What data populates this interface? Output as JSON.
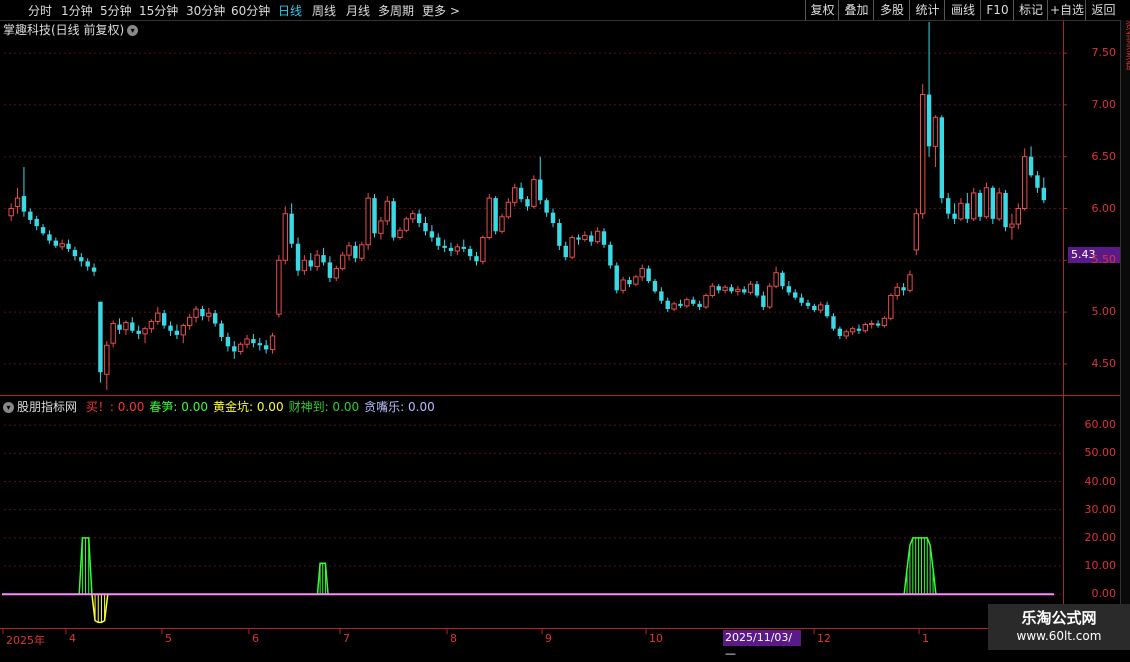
{
  "toolbar": {
    "periods": [
      "分时",
      "1分钟",
      "5分钟",
      "15分钟",
      "30分钟",
      "60分钟",
      "日线",
      "周线",
      "月线",
      "多周期",
      "更多 >"
    ],
    "active_period": "日线",
    "right_buttons": [
      "复权",
      "叠加",
      "多股",
      "统计",
      "画线",
      "F10",
      "标记",
      "+自选",
      "返回"
    ]
  },
  "chart_title": "掌趣科技(日线 前复权)",
  "price_axis": [
    "7.50",
    "7.00",
    "6.50",
    "6.00",
    "5.50",
    "5.00",
    "4.50"
  ],
  "current_price_tag": "5.43",
  "indicator": {
    "name": "股朋指标网",
    "items": [
      {
        "label": "买！:",
        "value": "0.00",
        "color": "#ff3333"
      },
      {
        "label": "春笋:",
        "value": "0.00",
        "color": "#33ff33"
      },
      {
        "label": "黄金坑:",
        "value": "0.00",
        "color": "#ffff33"
      },
      {
        "label": "财神到:",
        "value": "0.00",
        "color": "#33cc33"
      },
      {
        "label": "贪嘴乐:",
        "value": "0.00",
        "color": "#bbbbff"
      }
    ],
    "axis": [
      "60.00",
      "50.00",
      "40.00",
      "30.00",
      "20.00",
      "10.00",
      "0.00"
    ]
  },
  "date_axis": {
    "labels": [
      "2025年",
      "4",
      "5",
      "6",
      "7",
      "8",
      "9",
      "10",
      "11",
      "12",
      "1"
    ],
    "highlight": "2025/11/03/—"
  },
  "watermark": {
    "line1": "乐淘公式网",
    "line2": "www.60lt.com"
  },
  "side_panel_text": "资金买卖盘",
  "colors": {
    "up": "#e74c4c",
    "down": "#3ad9e6",
    "grid": "#5a1010",
    "axis": "#b22222",
    "baseline": "#ff88ff"
  },
  "chart_data": {
    "type": "candlestick",
    "ylim": [
      4.2,
      7.8
    ],
    "candles": [
      [
        5.93,
        6.05,
        5.88,
        6.0
      ],
      [
        6.02,
        6.2,
        5.95,
        6.1
      ],
      [
        6.12,
        6.4,
        5.92,
        5.97
      ],
      [
        5.97,
        6.0,
        5.85,
        5.89
      ],
      [
        5.9,
        5.93,
        5.79,
        5.83
      ],
      [
        5.82,
        5.85,
        5.74,
        5.76
      ],
      [
        5.75,
        5.79,
        5.66,
        5.69
      ],
      [
        5.69,
        5.72,
        5.62,
        5.64
      ],
      [
        5.63,
        5.7,
        5.6,
        5.66
      ],
      [
        5.66,
        5.7,
        5.58,
        5.61
      ],
      [
        5.6,
        5.63,
        5.5,
        5.54
      ],
      [
        5.53,
        5.57,
        5.44,
        5.49
      ],
      [
        5.49,
        5.52,
        5.4,
        5.44
      ],
      [
        5.43,
        5.47,
        5.35,
        5.39
      ],
      [
        5.1,
        5.1,
        4.32,
        4.42
      ],
      [
        4.4,
        4.72,
        4.25,
        4.68
      ],
      [
        4.7,
        4.92,
        4.66,
        4.89
      ],
      [
        4.88,
        4.94,
        4.79,
        4.83
      ],
      [
        4.83,
        4.92,
        4.78,
        4.9
      ],
      [
        4.9,
        4.95,
        4.8,
        4.82
      ],
      [
        4.82,
        4.87,
        4.74,
        4.79
      ],
      [
        4.79,
        4.86,
        4.7,
        4.84
      ],
      [
        4.84,
        4.93,
        4.8,
        4.91
      ],
      [
        4.91,
        5.05,
        4.88,
        4.99
      ],
      [
        4.99,
        5.02,
        4.84,
        4.87
      ],
      [
        4.87,
        4.91,
        4.77,
        4.82
      ],
      [
        4.82,
        4.88,
        4.74,
        4.78
      ],
      [
        4.78,
        4.89,
        4.7,
        4.87
      ],
      [
        4.87,
        4.98,
        4.83,
        4.95
      ],
      [
        4.95,
        5.06,
        4.9,
        5.03
      ],
      [
        5.03,
        5.06,
        4.92,
        4.96
      ],
      [
        4.96,
        5.04,
        4.91,
        4.99
      ],
      [
        4.99,
        5.02,
        4.86,
        4.89
      ],
      [
        4.89,
        4.92,
        4.72,
        4.76
      ],
      [
        4.76,
        4.8,
        4.62,
        4.67
      ],
      [
        4.67,
        4.72,
        4.55,
        4.62
      ],
      [
        4.62,
        4.71,
        4.59,
        4.69
      ],
      [
        4.69,
        4.78,
        4.65,
        4.74
      ],
      [
        4.74,
        4.79,
        4.66,
        4.7
      ],
      [
        4.7,
        4.75,
        4.63,
        4.68
      ],
      [
        4.68,
        4.73,
        4.6,
        4.64
      ],
      [
        4.64,
        4.8,
        4.6,
        4.77
      ],
      [
        4.98,
        5.55,
        4.95,
        5.5
      ],
      [
        5.5,
        6.02,
        5.46,
        5.95
      ],
      [
        5.95,
        6.05,
        5.62,
        5.66
      ],
      [
        5.66,
        5.72,
        5.35,
        5.4
      ],
      [
        5.4,
        5.55,
        5.36,
        5.5
      ],
      [
        5.5,
        5.57,
        5.4,
        5.44
      ],
      [
        5.44,
        5.6,
        5.4,
        5.55
      ],
      [
        5.55,
        5.62,
        5.45,
        5.48
      ],
      [
        5.48,
        5.54,
        5.29,
        5.33
      ],
      [
        5.33,
        5.45,
        5.3,
        5.42
      ],
      [
        5.42,
        5.58,
        5.4,
        5.55
      ],
      [
        5.55,
        5.68,
        5.5,
        5.64
      ],
      [
        5.64,
        5.68,
        5.48,
        5.52
      ],
      [
        5.52,
        5.68,
        5.49,
        5.65
      ],
      [
        5.65,
        6.15,
        5.6,
        6.1
      ],
      [
        6.1,
        6.14,
        5.72,
        5.76
      ],
      [
        5.76,
        5.92,
        5.7,
        5.88
      ],
      [
        5.88,
        6.12,
        5.84,
        6.07
      ],
      [
        6.07,
        6.1,
        5.69,
        5.72
      ],
      [
        5.72,
        5.82,
        5.7,
        5.79
      ],
      [
        5.79,
        5.92,
        5.77,
        5.9
      ],
      [
        5.9,
        5.98,
        5.86,
        5.95
      ],
      [
        5.95,
        5.99,
        5.82,
        5.86
      ],
      [
        5.86,
        5.92,
        5.74,
        5.78
      ],
      [
        5.78,
        5.84,
        5.68,
        5.72
      ],
      [
        5.72,
        5.76,
        5.6,
        5.64
      ],
      [
        5.64,
        5.7,
        5.58,
        5.62
      ],
      [
        5.62,
        5.67,
        5.54,
        5.59
      ],
      [
        5.59,
        5.66,
        5.55,
        5.63
      ],
      [
        5.63,
        5.7,
        5.58,
        5.61
      ],
      [
        5.61,
        5.64,
        5.5,
        5.54
      ],
      [
        5.54,
        5.58,
        5.45,
        5.49
      ],
      [
        5.49,
        5.74,
        5.46,
        5.72
      ],
      [
        5.72,
        6.14,
        5.7,
        6.1
      ],
      [
        6.1,
        6.12,
        5.75,
        5.78
      ],
      [
        5.78,
        5.95,
        5.76,
        5.92
      ],
      [
        5.92,
        6.1,
        5.9,
        6.06
      ],
      [
        6.06,
        6.24,
        6.02,
        6.2
      ],
      [
        6.2,
        6.25,
        6.06,
        6.09
      ],
      [
        6.09,
        6.12,
        5.98,
        6.02
      ],
      [
        6.02,
        6.32,
        6.0,
        6.28
      ],
      [
        6.28,
        6.5,
        6.04,
        6.08
      ],
      [
        6.08,
        6.1,
        5.92,
        5.96
      ],
      [
        5.96,
        6.0,
        5.82,
        5.86
      ],
      [
        5.86,
        5.9,
        5.6,
        5.64
      ],
      [
        5.64,
        5.68,
        5.5,
        5.53
      ],
      [
        5.53,
        5.74,
        5.51,
        5.72
      ],
      [
        5.72,
        5.75,
        5.65,
        5.7
      ],
      [
        5.7,
        5.78,
        5.68,
        5.74
      ],
      [
        5.74,
        5.78,
        5.64,
        5.68
      ],
      [
        5.68,
        5.82,
        5.66,
        5.78
      ],
      [
        5.78,
        5.81,
        5.62,
        5.65
      ],
      [
        5.65,
        5.68,
        5.42,
        5.45
      ],
      [
        5.45,
        5.48,
        5.18,
        5.21
      ],
      [
        5.21,
        5.34,
        5.18,
        5.31
      ],
      [
        5.31,
        5.34,
        5.24,
        5.27
      ],
      [
        5.27,
        5.36,
        5.25,
        5.34
      ],
      [
        5.34,
        5.46,
        5.3,
        5.42
      ],
      [
        5.42,
        5.45,
        5.28,
        5.3
      ],
      [
        5.3,
        5.32,
        5.18,
        5.2
      ],
      [
        5.2,
        5.24,
        5.08,
        5.11
      ],
      [
        5.11,
        5.14,
        5.0,
        5.03
      ],
      [
        5.03,
        5.1,
        5.01,
        5.08
      ],
      [
        5.08,
        5.12,
        5.04,
        5.06
      ],
      [
        5.06,
        5.14,
        5.04,
        5.12
      ],
      [
        5.12,
        5.15,
        5.06,
        5.08
      ],
      [
        5.08,
        5.11,
        5.02,
        5.05
      ],
      [
        5.05,
        5.18,
        5.03,
        5.16
      ],
      [
        5.16,
        5.28,
        5.14,
        5.25
      ],
      [
        5.25,
        5.27,
        5.18,
        5.21
      ],
      [
        5.21,
        5.26,
        5.18,
        5.24
      ],
      [
        5.24,
        5.27,
        5.18,
        5.2
      ],
      [
        5.2,
        5.25,
        5.16,
        5.22
      ],
      [
        5.22,
        5.25,
        5.17,
        5.19
      ],
      [
        5.19,
        5.3,
        5.17,
        5.27
      ],
      [
        5.27,
        5.3,
        5.14,
        5.16
      ],
      [
        5.16,
        5.2,
        5.02,
        5.05
      ],
      [
        5.05,
        5.28,
        5.03,
        5.25
      ],
      [
        5.25,
        5.44,
        5.23,
        5.38
      ],
      [
        5.38,
        5.4,
        5.22,
        5.25
      ],
      [
        5.25,
        5.3,
        5.16,
        5.19
      ],
      [
        5.19,
        5.22,
        5.12,
        5.14
      ],
      [
        5.14,
        5.18,
        5.06,
        5.09
      ],
      [
        5.09,
        5.12,
        5.03,
        5.06
      ],
      [
        5.06,
        5.08,
        5.0,
        5.02
      ],
      [
        5.02,
        5.1,
        4.99,
        5.07
      ],
      [
        5.07,
        5.1,
        4.94,
        4.96
      ],
      [
        4.96,
        4.99,
        4.82,
        4.84
      ],
      [
        4.84,
        4.86,
        4.74,
        4.77
      ],
      [
        4.77,
        4.83,
        4.74,
        4.81
      ],
      [
        4.81,
        4.86,
        4.78,
        4.84
      ],
      [
        4.84,
        4.88,
        4.79,
        4.82
      ],
      [
        4.82,
        4.9,
        4.8,
        4.88
      ],
      [
        4.88,
        4.92,
        4.84,
        4.89
      ],
      [
        4.89,
        4.92,
        4.85,
        4.87
      ],
      [
        4.87,
        4.96,
        4.85,
        4.94
      ],
      [
        4.94,
        5.18,
        4.92,
        5.16
      ],
      [
        5.16,
        5.28,
        5.12,
        5.24
      ],
      [
        5.24,
        5.28,
        5.16,
        5.21
      ],
      [
        5.21,
        5.4,
        5.19,
        5.36
      ],
      [
        5.6,
        6.0,
        5.55,
        5.95
      ],
      [
        5.95,
        7.2,
        5.9,
        7.1
      ],
      [
        7.1,
        7.8,
        6.5,
        6.6
      ],
      [
        6.6,
        6.9,
        6.4,
        6.88
      ],
      [
        6.88,
        6.9,
        6.05,
        6.1
      ],
      [
        6.1,
        6.15,
        5.9,
        5.95
      ],
      [
        5.95,
        6.05,
        5.85,
        5.9
      ],
      [
        5.9,
        6.1,
        5.88,
        6.05
      ],
      [
        6.05,
        6.15,
        5.86,
        5.9
      ],
      [
        5.9,
        6.2,
        5.88,
        6.15
      ],
      [
        6.15,
        6.18,
        5.88,
        5.92
      ],
      [
        5.92,
        6.25,
        5.9,
        6.2
      ],
      [
        6.2,
        6.22,
        5.85,
        5.9
      ],
      [
        5.9,
        6.2,
        5.88,
        6.15
      ],
      [
        6.15,
        6.18,
        5.78,
        5.82
      ],
      [
        5.82,
        5.95,
        5.7,
        5.85
      ],
      [
        5.85,
        6.05,
        5.8,
        6.0
      ],
      [
        6.0,
        6.58,
        5.98,
        6.5
      ],
      [
        6.5,
        6.6,
        6.3,
        6.32
      ],
      [
        6.32,
        6.36,
        6.15,
        6.2
      ],
      [
        6.2,
        6.3,
        6.05,
        6.08
      ]
    ],
    "indicator_series": {
      "ylim": [
        -12,
        70
      ],
      "green_bursts": [
        {
          "start": 0.071,
          "end": 0.083,
          "peak": 20
        },
        {
          "start": 0.296,
          "end": 0.306,
          "peak": 11
        },
        {
          "start": 0.85,
          "end": 0.88,
          "peak": 20
        }
      ],
      "yellow_bursts": [
        {
          "start": 0.083,
          "end": 0.098,
          "peak": -10
        }
      ]
    }
  }
}
